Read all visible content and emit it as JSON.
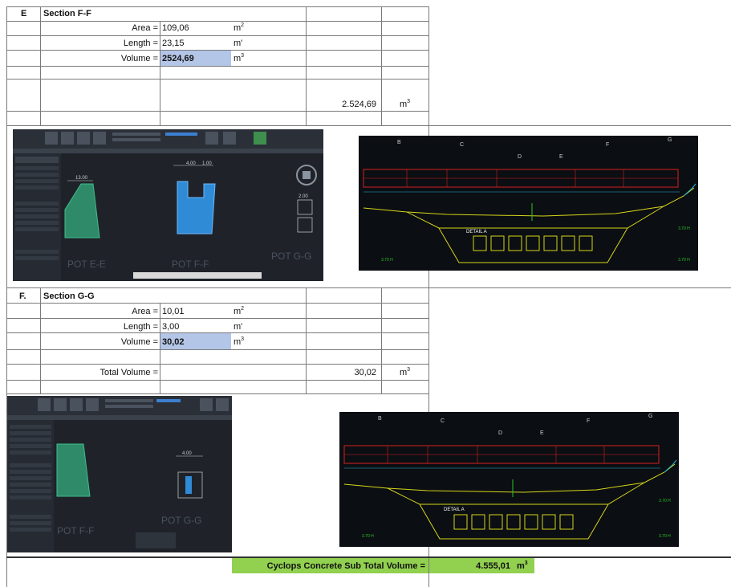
{
  "section_e": {
    "letter": "E",
    "title": "Section F-F",
    "area_label": "Area =",
    "area_value": "109,06",
    "area_unit": "m",
    "area_unit_sup": "2",
    "length_label": "Length =",
    "length_value": "23,15",
    "length_unit": "m'",
    "volume_label": "Volume =",
    "volume_value": "2524,69",
    "volume_unit": "m",
    "volume_unit_sup": "3",
    "total_value": "2.524,69",
    "total_unit": "m",
    "total_unit_sup": "3"
  },
  "section_f": {
    "letter": "F.",
    "title": "Section G-G",
    "area_label": "Area =",
    "area_value": "10,01",
    "area_unit": "m",
    "area_unit_sup": "2",
    "length_label": "Length =",
    "length_value": "3,00",
    "length_unit": "m'",
    "volume_label": "Volume =",
    "volume_value": "30,02",
    "volume_unit": "m",
    "volume_unit_sup": "3",
    "total_label": "Total Volume =",
    "total_value": "30,02",
    "total_unit": "m",
    "total_unit_sup": "3"
  },
  "subtotal": {
    "label": "Cyclops Concrete Sub Total Volume  =",
    "value": "4.555,01",
    "unit": "m",
    "unit_sup": "3"
  },
  "images": {
    "e_left_labels": [
      "POT E-E",
      "POT F-F",
      "POT G-G"
    ],
    "e_left_dims": [
      "13.00",
      "4.00",
      "1.00",
      "2.00"
    ],
    "e_right_detail": "DETAIL A",
    "e_right_cols": [
      "B",
      "C",
      "D",
      "E",
      "F",
      "G"
    ],
    "f_left_labels": [
      "POT F-F",
      "POT G-G"
    ],
    "f_left_dims": [
      "4.00"
    ],
    "f_right_detail": "DETAIL A",
    "f_right_cols": [
      "B",
      "C",
      "D",
      "E",
      "F",
      "G"
    ]
  },
  "colors": {
    "highlight_blue": "#b4c6e7",
    "highlight_green": "#92d050",
    "section_fill": "#2f8bd6",
    "cad_red": "#d42020",
    "cad_yellow": "#d6d61a",
    "cad_green": "#28c828",
    "cad_cyan": "#22b8d8"
  }
}
